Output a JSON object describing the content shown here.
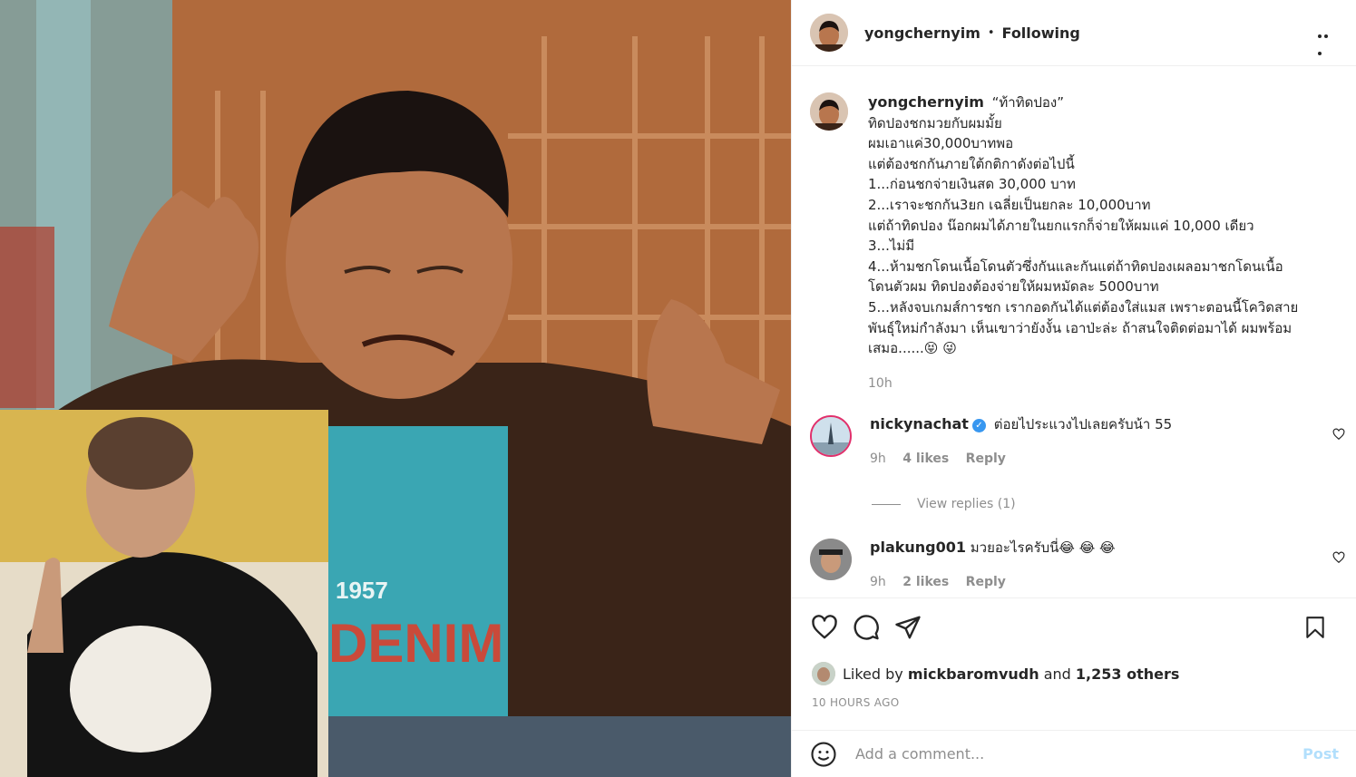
{
  "post": {
    "author": "yongchernyim",
    "separator": "•",
    "follow_status": "Following",
    "caption_lines": [
      "“ท้าทิดปอง”",
      "ทิดปองชกมวยกับผมมั้ย",
      "ผมเอาแค่30,000บาทพอ",
      "แต่ต้องชกกันภายใต้กติกาดังต่อไปนี้",
      "1...ก่อนชกจ่ายเงินสด 30,000 บาท",
      "2...เราจะชกกัน3ยก เฉลี่ยเป็นยกละ 10,000บาท",
      "แต่ถ้าทิดปอง น๊อกผมได้ภายในยกแรกก็จ่ายให้ผมแค่ 10,000 เดียว",
      "3...ไม่มี",
      "4...ห้ามชกโดนเนื้อโดนตัวซึ่งกันและกันแต่ถ้าทิดปองเผลอมาชกโดนเนื้อ",
      "โดนตัวผม ทิดปองต้องจ่ายให้ผมหมัดละ 5000บาท",
      "5...หลังจบเกมส์การชก เรากอดกันได้แต่ต้องใส่แมส เพราะตอนนี้โควิดสาย",
      "พันธุ์ใหม่กำลังมา เห็นเขาว่ายังงั้น เอาป่ะล่ะ ถ้าสนใจติดต่อมาได้ ผมพร้อม",
      "เสมอ......😝 😜"
    ],
    "caption_time": "10h"
  },
  "comments": [
    {
      "username": "nickynachat",
      "verified": "✓",
      "text": "ต่อยไประแวงไปเลยครับน้า 55",
      "time": "9h",
      "likes": "4 likes",
      "reply": "Reply",
      "view_replies": "View replies (1)"
    },
    {
      "username": "plakung001",
      "text": "มวยอะไรครับนี่😂 😂 😂",
      "time": "9h",
      "likes": "2 likes",
      "reply": "Reply"
    }
  ],
  "actions": {
    "liked_by_prefix": "Liked by",
    "liked_by_user": "mickbaromvudh",
    "liked_by_and": "and",
    "liked_by_others": "1,253 others",
    "posted_ago": "10 HOURS AGO"
  },
  "add_comment": {
    "placeholder": "Add a comment...",
    "post_label": "Post",
    "emoji_icon": "emoji-smile-icon"
  },
  "icons": {
    "like": "heart-icon",
    "comment": "comment-bubble-icon",
    "share": "paper-plane-icon",
    "save": "bookmark-icon",
    "more": "more-options-icon"
  }
}
